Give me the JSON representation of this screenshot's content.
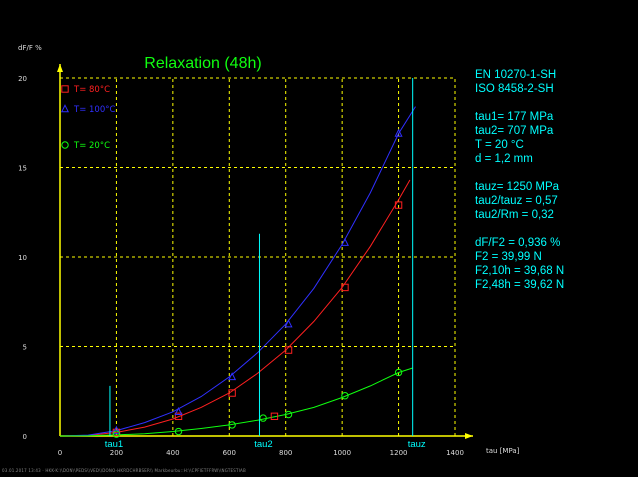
{
  "chart_data": {
    "type": "line",
    "title": "Relaxation (48h)",
    "ylabel": "dF/F %",
    "xlabel": "tau [MPa]",
    "xlim": [
      0,
      1400
    ],
    "ylim": [
      0,
      20
    ],
    "xticks": [
      0,
      200,
      400,
      600,
      800,
      1000,
      1200,
      1400
    ],
    "yticks": [
      0,
      5,
      10,
      15,
      20
    ],
    "grid": true,
    "series": [
      {
        "name": "T= 80°C",
        "color": "#ff2020",
        "marker": "square",
        "curve": [
          [
            0,
            0
          ],
          [
            100,
            0.03
          ],
          [
            200,
            0.2
          ],
          [
            300,
            0.5
          ],
          [
            400,
            0.95
          ],
          [
            500,
            1.6
          ],
          [
            600,
            2.4
          ],
          [
            700,
            3.5
          ],
          [
            800,
            4.8
          ],
          [
            900,
            6.4
          ],
          [
            1000,
            8.3
          ],
          [
            1100,
            10.6
          ],
          [
            1200,
            13.2
          ],
          [
            1240,
            14.3
          ]
        ],
        "points": [
          [
            200,
            0.2
          ],
          [
            420,
            1.1
          ],
          [
            610,
            2.4
          ],
          [
            760,
            1.1
          ],
          [
            810,
            4.8
          ],
          [
            1010,
            8.3
          ],
          [
            1200,
            12.9
          ]
        ]
      },
      {
        "name": "T= 100°C",
        "color": "#3030ff",
        "marker": "triangle",
        "curve": [
          [
            0,
            0
          ],
          [
            100,
            0.05
          ],
          [
            200,
            0.3
          ],
          [
            300,
            0.75
          ],
          [
            400,
            1.35
          ],
          [
            500,
            2.2
          ],
          [
            600,
            3.3
          ],
          [
            700,
            4.65
          ],
          [
            800,
            6.25
          ],
          [
            900,
            8.25
          ],
          [
            1000,
            10.7
          ],
          [
            1100,
            13.6
          ],
          [
            1200,
            16.9
          ],
          [
            1260,
            18.4
          ]
        ],
        "points": [
          [
            200,
            0.3
          ],
          [
            420,
            1.35
          ],
          [
            610,
            3.3
          ],
          [
            810,
            6.25
          ],
          [
            1010,
            10.8
          ],
          [
            1200,
            16.9
          ]
        ]
      },
      {
        "name": "T= 20°C",
        "color": "#10ff10",
        "marker": "circle",
        "curve": [
          [
            0,
            0
          ],
          [
            100,
            0.01
          ],
          [
            200,
            0.06
          ],
          [
            300,
            0.13
          ],
          [
            400,
            0.25
          ],
          [
            500,
            0.42
          ],
          [
            600,
            0.62
          ],
          [
            700,
            0.88
          ],
          [
            800,
            1.2
          ],
          [
            900,
            1.6
          ],
          [
            1000,
            2.15
          ],
          [
            1100,
            2.8
          ],
          [
            1200,
            3.55
          ],
          [
            1250,
            3.8
          ]
        ],
        "points": [
          [
            200,
            0.1
          ],
          [
            420,
            0.25
          ],
          [
            610,
            0.62
          ],
          [
            720,
            1.0
          ],
          [
            810,
            1.2
          ],
          [
            1010,
            2.25
          ],
          [
            1200,
            3.55
          ]
        ]
      }
    ],
    "markers": [
      {
        "label": "tau1",
        "x": 177,
        "y_top": 2.8
      },
      {
        "label": "tau2",
        "x": 707,
        "y_top": 11.3
      },
      {
        "label": "tauz",
        "x": 1250,
        "y_top": 20.0
      }
    ]
  },
  "info": {
    "lines1": [
      "EN 10270-1-SH",
      "ISO 8458-2-SH"
    ],
    "lines2": [
      "tau1=  177 MPa",
      "tau2=  707 MPa",
      "T = 20 °C",
      "d = 1,2 mm"
    ],
    "lines3": [
      "tauz= 1250 MPa",
      "tau2/tauz = 0,57",
      "tau2/Rm = 0,32"
    ],
    "lines4": [
      "dF/F2 = 0,936 %",
      "F2 = 39,99 N",
      "F2,10h = 39,68 N",
      "F2,48h = 39,62 N"
    ]
  },
  "footer": "03.01.2017 13:43 · HKK-K:\\\\DON\\\\PEDS\\\\VED\\\\DONO-HKRDCHRBSER\\\\ Markbeurbu::H:\\\\CPFIETFFRW\\\\NGTESTIAB"
}
